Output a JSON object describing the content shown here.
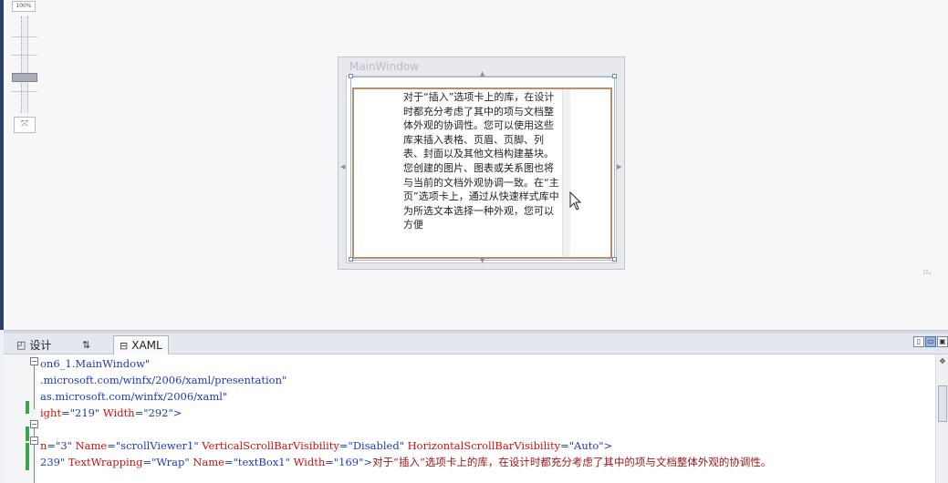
{
  "design": {
    "zoom_label": "100%",
    "window_title": "MainWindow",
    "textbox_content": "对于“插入”选项卡上的库，在设计时都充分考虑了其中的项与文档整体外观的协调性。您可以使用这些库来插入表格、页眉、页脚、列表、封面以及其他文档构建基块。您创建的图片、图表或关系图也将与当前的文档外观协调一致。在“主页”选项卡上，通过从快速样式库中为所选文本选择一种外观，您可以方便"
  },
  "tabs": {
    "design_label": "设计",
    "swap_label": "⇅",
    "xaml_label": "XAML"
  },
  "editor": {
    "lines": [
      {
        "segments": [
          {
            "text": "on6_1.MainWindow\"",
            "cls": "c-str"
          }
        ]
      },
      {
        "segments": [
          {
            "text": ".microsoft.com/winfx/2006/xaml/presentation\"",
            "cls": "c-str"
          }
        ]
      },
      {
        "segments": [
          {
            "text": "as.microsoft.com/winfx/2006/xaml\"",
            "cls": "c-str"
          }
        ]
      },
      {
        "segments": [
          {
            "text": "ight",
            "cls": "c-attr"
          },
          {
            "text": "=\"219\" ",
            "cls": "c-str"
          },
          {
            "text": "Width",
            "cls": "c-attr"
          },
          {
            "text": "=\"292\">",
            "cls": "c-str"
          }
        ]
      },
      {
        "segments": [
          {
            "text": "",
            "cls": "c-str"
          }
        ]
      },
      {
        "segments": [
          {
            "text": "n",
            "cls": "c-attr"
          },
          {
            "text": "=\"3\" ",
            "cls": "c-str"
          },
          {
            "text": "Name",
            "cls": "c-attr"
          },
          {
            "text": "=\"scrollViewer1\" ",
            "cls": "c-str"
          },
          {
            "text": "VerticalScrollBarVisibility",
            "cls": "c-attr"
          },
          {
            "text": "=\"Disabled\" ",
            "cls": "c-str"
          },
          {
            "text": "HorizontalScrollBarVisibility",
            "cls": "c-attr"
          },
          {
            "text": "=\"Auto\">",
            "cls": "c-str"
          }
        ]
      },
      {
        "segments": [
          {
            "text": "239\" ",
            "cls": "c-str"
          },
          {
            "text": "TextWrapping",
            "cls": "c-attr"
          },
          {
            "text": "=\"Wrap\" ",
            "cls": "c-str"
          },
          {
            "text": "Name",
            "cls": "c-attr"
          },
          {
            "text": "=\"textBox1\" ",
            "cls": "c-str"
          },
          {
            "text": "Width",
            "cls": "c-attr"
          },
          {
            "text": "=\"169\">",
            "cls": "c-str"
          },
          {
            "text": "对于“插入”选项卡上的库，在设计时都充分考虑了其中的项与文档整体外观的协调性。",
            "cls": "c-tag"
          }
        ]
      },
      {
        "segments": [
          {
            "text": "",
            "cls": "c-str"
          }
        ]
      }
    ]
  },
  "colors": {
    "accent": "#9ab2df",
    "change_bar": "#3fa34d",
    "attr_red": "#d10f0f",
    "string_blue": "#1d38c4"
  },
  "icons": {
    "design": "design-view-icon",
    "swap": "swap-panes-icon",
    "xaml": "xaml-view-icon",
    "cursor": "mouse-pointer-icon"
  }
}
